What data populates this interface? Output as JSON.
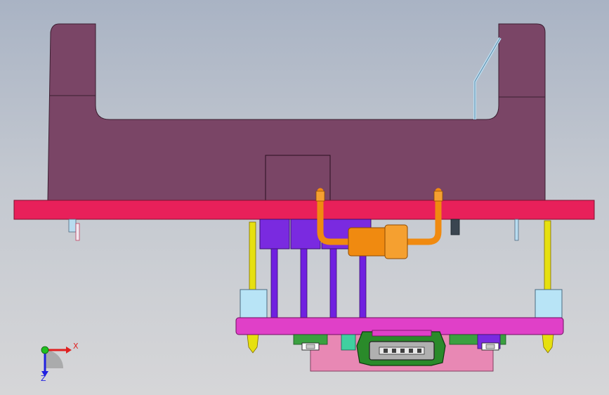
{
  "viewport": {
    "colors": {
      "background_top": "#a9b3c4",
      "background_bottom": "#d6d6d8",
      "housing": "#7a4566",
      "top_plate": "#e8205a",
      "bottom_plate": "#e040c8",
      "standoff_post": "#e6e010",
      "spacer_block": "#b8e4f6",
      "connector_block": "#7a2ae0",
      "coax_cable": "#f08a10",
      "sub_board": "#e888b4",
      "usb_connector": "#2a8a2a"
    },
    "triad": {
      "x_label": "X",
      "z_label": "Z",
      "x_color": "#e02020",
      "y_color": "#20c020",
      "z_color": "#2020e0"
    }
  }
}
